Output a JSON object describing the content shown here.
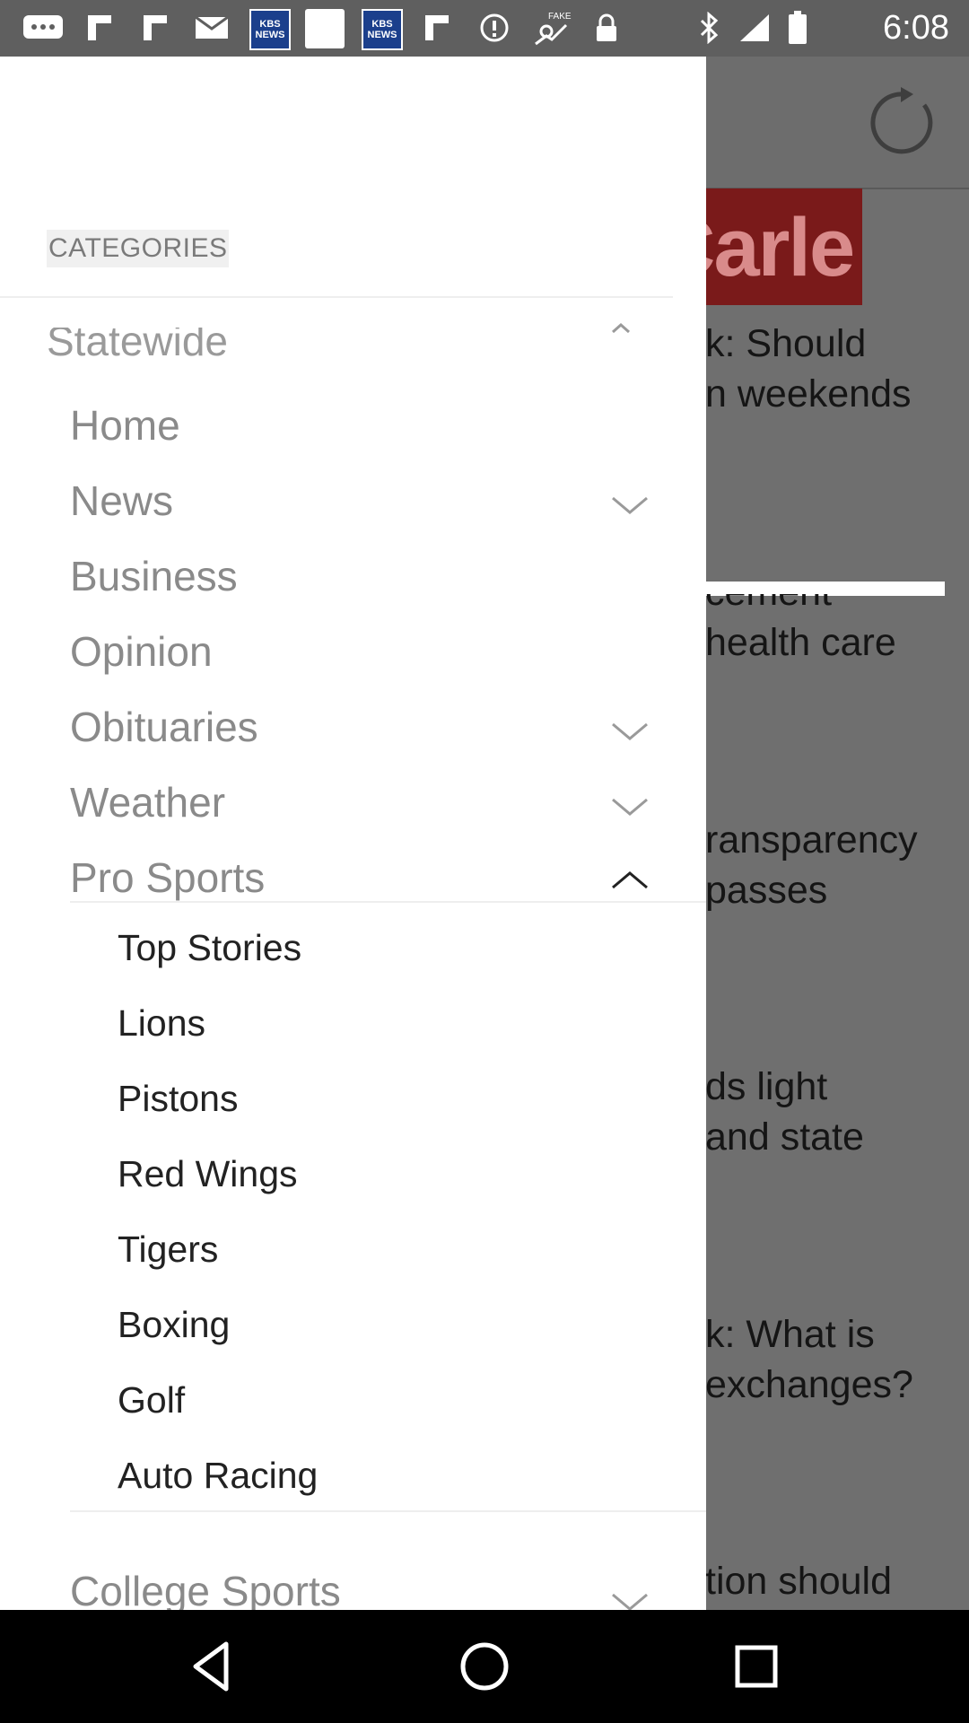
{
  "status_bar": {
    "time": "6:08",
    "icons": [
      "messages-icon",
      "flipboard-icon",
      "flipboard-icon",
      "email-icon",
      "kbs-news-icon",
      "blank-notification-icon",
      "kbs-news-icon",
      "flipboard-icon",
      "data-saver-icon",
      "fake-gps-icon",
      "lock-icon",
      "bluetooth-icon",
      "signal-icon",
      "battery-icon"
    ],
    "kbs_label": "KBS\nNEWS",
    "fake_label": "FAKE"
  },
  "background": {
    "banner_text": "Carle",
    "headlines": [
      "k: Should",
      "n weekends",
      "cement",
      "health care",
      "ransparency",
      "passes",
      "ds light",
      "and state",
      "k: What is",
      "exchanges?",
      "tion should"
    ]
  },
  "drawer": {
    "categories_label": "CATEGORIES",
    "section": "Statewide",
    "items": [
      {
        "label": "Home",
        "chevron": "none"
      },
      {
        "label": "News",
        "chevron": "down"
      },
      {
        "label": "Business",
        "chevron": "none"
      },
      {
        "label": "Opinion",
        "chevron": "none"
      },
      {
        "label": "Obituaries",
        "chevron": "down"
      },
      {
        "label": "Weather",
        "chevron": "down"
      },
      {
        "label": "Pro Sports",
        "chevron": "up"
      }
    ],
    "pro_sports_sub": [
      "Top Stories",
      "Lions",
      "Pistons",
      "Red Wings",
      "Tigers",
      "Boxing",
      "Golf",
      "Auto Racing"
    ],
    "next_item": {
      "label": "College Sports",
      "chevron": "down"
    }
  },
  "nav_bar": {
    "buttons": [
      "back-icon",
      "home-icon",
      "recents-icon"
    ]
  }
}
